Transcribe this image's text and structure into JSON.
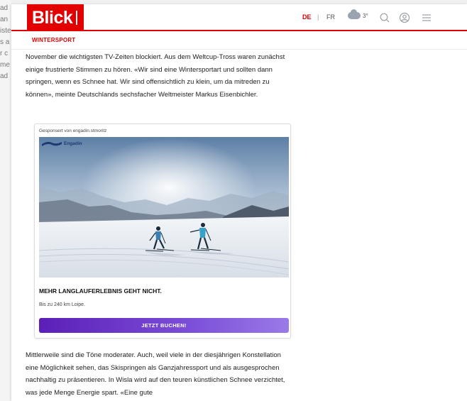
{
  "header": {
    "logo_text": "Blick",
    "lang_de": "DE",
    "lang_separator": "|",
    "lang_fr": "FR",
    "weather_icon": "cloud-icon",
    "temperature": "3°",
    "icons": [
      "search-icon",
      "user-icon",
      "menu-icon"
    ]
  },
  "section": {
    "label": "WINTERSPORT"
  },
  "article": {
    "paragraph1": "November die wichtigsten TV-Zeiten blockiert. Aus dem Weltcup-Tross waren zunächst einige frustrierte Stimmen zu hören. «Wir sind eine Wintersportart und sollten dann springen, wenn es Schnee hat. Wir sind offensichtlich zu klein, um da mitreden zu können», meinte Deutschlands sechsfacher Weltmeister Markus Eisenbichler.",
    "paragraph2": "Mittlerweile sind die Töne moderater. Auch, weil viele in der diesjährigen Konstellation eine Möglichkeit sehen, das Skispringen als Ganzjahressport und als ausgesprochen nachhaltig zu präsentieren. In Wisla wird auf den teuren künstlichen Schnee verzichtet, was jede Menge Energie spart. «Eine gute"
  },
  "ad": {
    "sponsor_label": "Gesponsert von engadin.stmoritz",
    "logo_label": "Engadin",
    "headline": "MEHR LANGLAUFERLEBNIS GEHT NICHT.",
    "subline": "Bis zu 240 km Loipe.",
    "cta_label": "JETZT BUCHEN!"
  },
  "colors": {
    "brand_red": "#e20000",
    "cta_purple": "#5b1fb8"
  }
}
